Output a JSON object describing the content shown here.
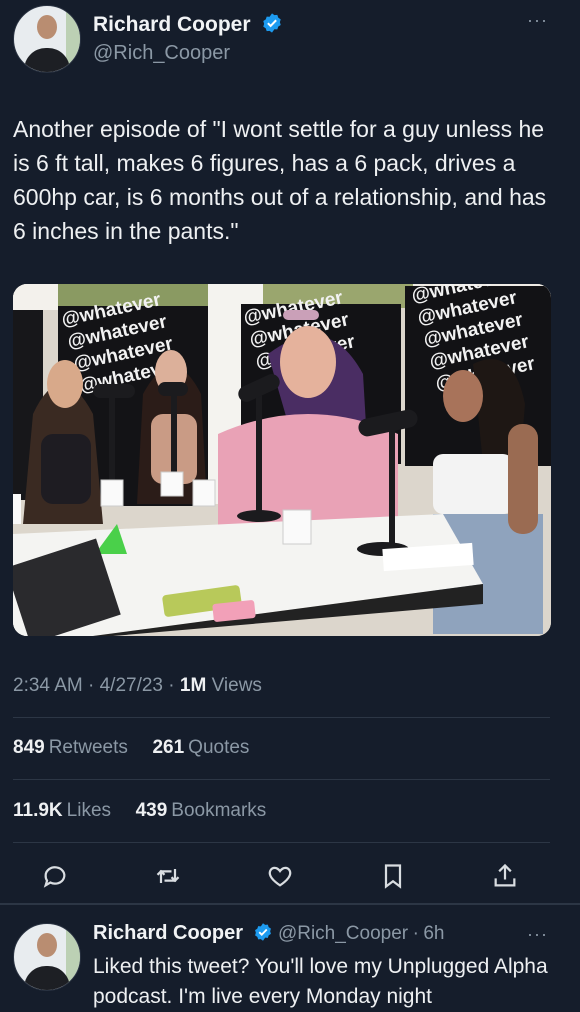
{
  "tweet": {
    "author_name": "Richard Cooper",
    "author_handle": "@Rich_Cooper",
    "more_label": "···",
    "text": "Another episode of \"I wont settle for a guy unless he is 6 ft tall, makes 6 figures, has a 6 pack, drives a 600hp car, is 6 months out of a relationship, and has 6 inches in the pants.\"",
    "media": {
      "banner_text": "@whatever"
    },
    "time": "2:34 AM",
    "date": "4/27/23",
    "views_count": "1M",
    "views_label": "Views",
    "retweets_count": "849",
    "retweets_label": "Retweets",
    "quotes_count": "261",
    "quotes_label": "Quotes",
    "likes_count": "11.9K",
    "likes_label": "Likes",
    "bookmarks_count": "439",
    "bookmarks_label": "Bookmarks"
  },
  "actions": [
    "reply-icon",
    "retweet-icon",
    "like-icon",
    "bookmark-icon",
    "share-icon"
  ],
  "reply": {
    "author_name": "Richard Cooper",
    "author_handle": "@Rich_Cooper",
    "time_ago": "6h",
    "text": "Liked this tweet?  You'll love my Unplugged Alpha podcast. I'm live every Monday night"
  },
  "colors": {
    "background": "#151d2b",
    "verified": "#1d9bf0",
    "muted": "#8b98a5"
  }
}
